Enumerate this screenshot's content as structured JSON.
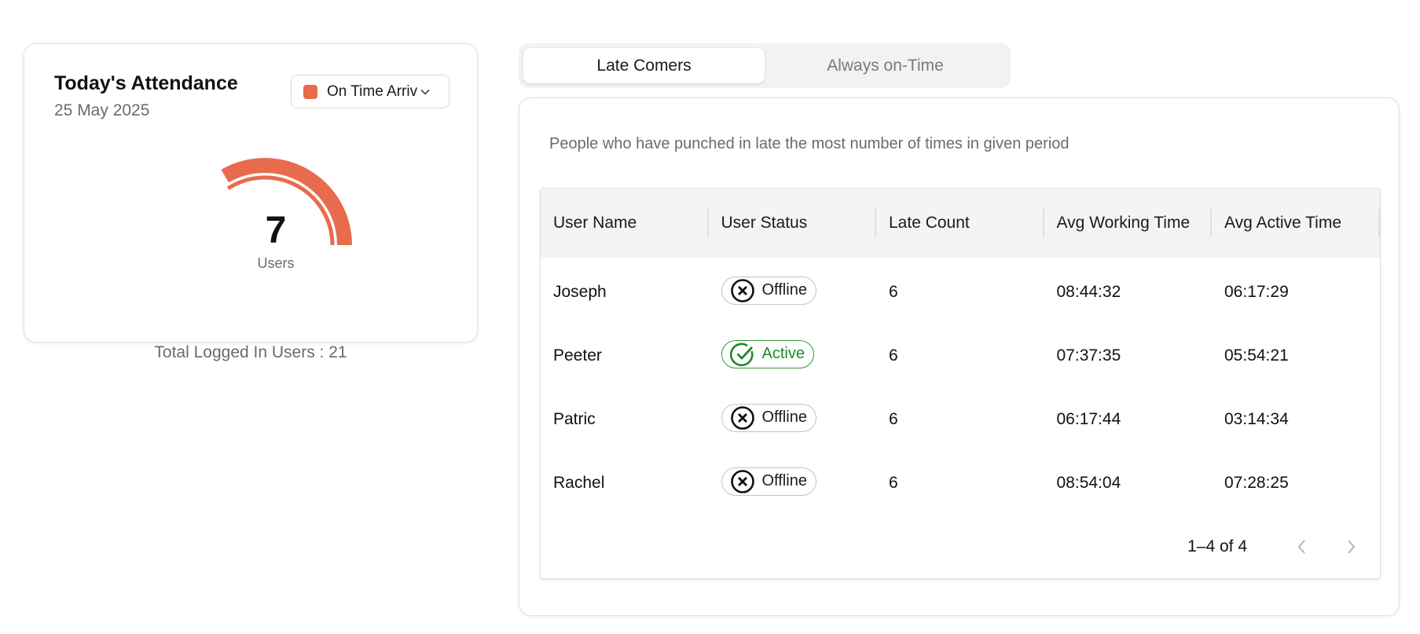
{
  "attendance": {
    "title": "Today's Attendance",
    "date": "25 May 2025",
    "filter": {
      "label": "On Time Arriv",
      "swatch_color": "#E86B4D",
      "icon": "chevron-down-icon"
    },
    "gauge": {
      "value": "7",
      "label": "Users",
      "fill_fraction": 0.333,
      "color": "#E86B4D"
    },
    "total_text": "Total Logged In Users : 21"
  },
  "tabs": [
    {
      "label": "Late Comers",
      "active": true
    },
    {
      "label": "Always on-Time",
      "active": false
    }
  ],
  "panel": {
    "description": "People who have punched in late the most number of times in given period"
  },
  "table": {
    "columns": [
      "User Name",
      "User Status",
      "Late Count",
      "Avg Working Time",
      "Avg Active Time"
    ],
    "rows": [
      {
        "name": "Joseph",
        "status": "Offline",
        "late": "6",
        "working": "08:44:32",
        "active": "06:17:29"
      },
      {
        "name": "Peeter",
        "status": "Active",
        "late": "6",
        "working": "07:37:35",
        "active": "05:54:21"
      },
      {
        "name": "Patric",
        "status": "Offline",
        "late": "6",
        "working": "06:17:44",
        "active": "03:14:34"
      },
      {
        "name": "Rachel",
        "status": "Offline",
        "late": "6",
        "working": "08:54:04",
        "active": "07:28:25"
      }
    ],
    "pagination": {
      "text": "1–4 of 4",
      "prev_icon": "chevron-left-icon",
      "next_icon": "chevron-right-icon"
    }
  },
  "colors": {
    "accent": "#E86B4D",
    "active_green": "#1d8a2a",
    "muted_text": "#6b6b6b"
  }
}
